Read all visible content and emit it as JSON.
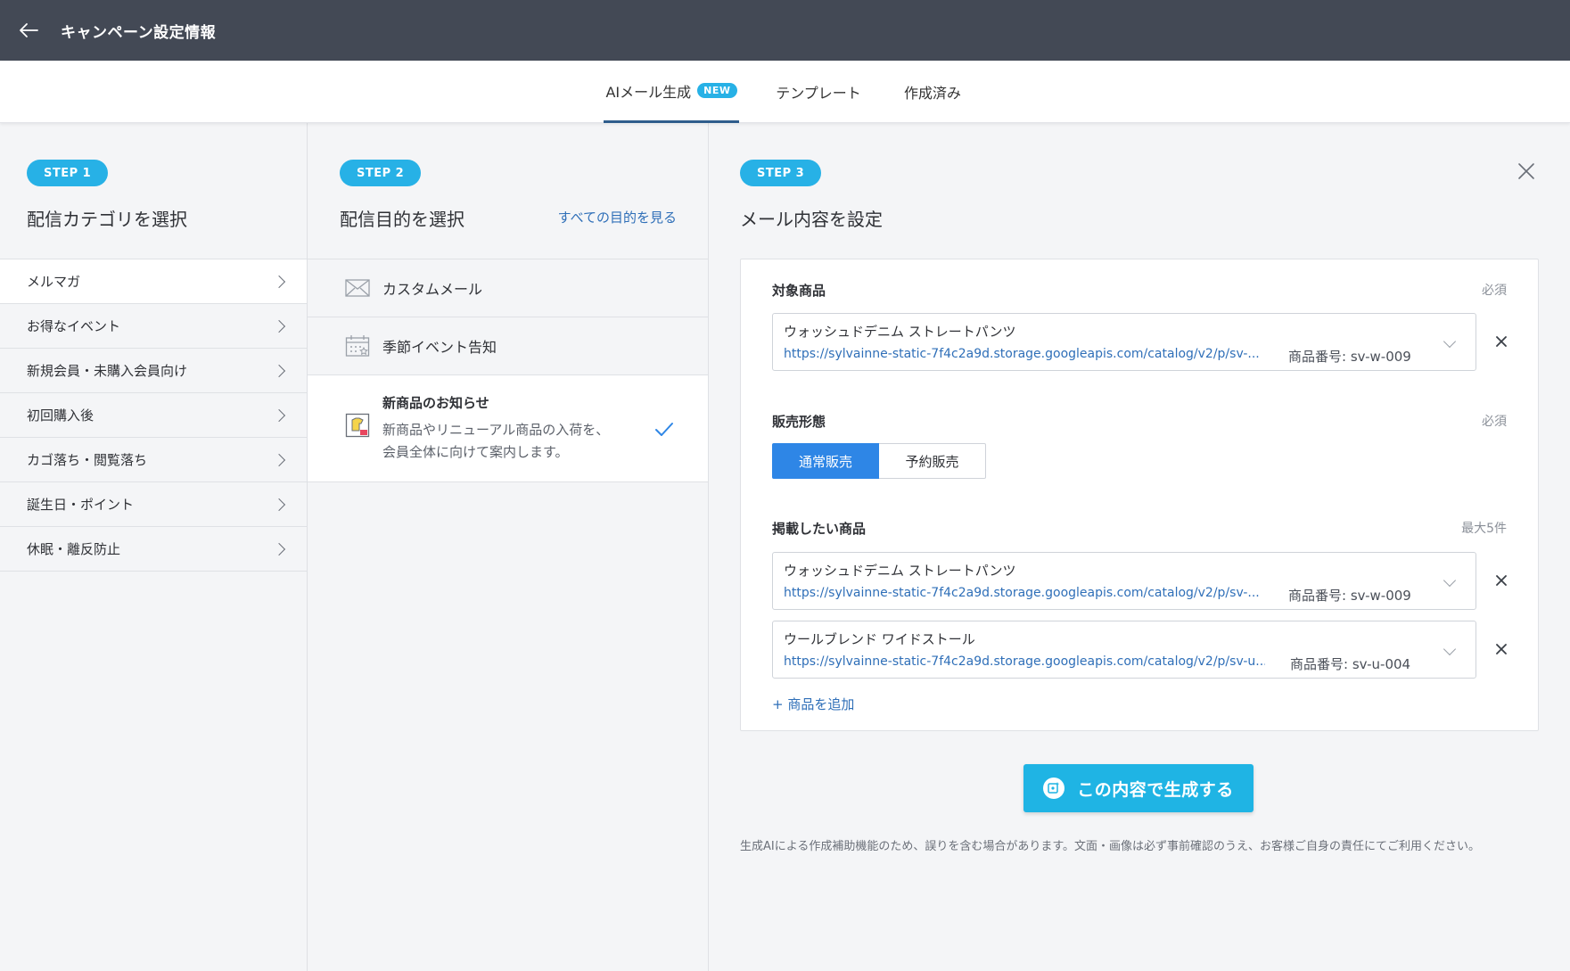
{
  "header": {
    "title": "キャンペーン設定情報"
  },
  "tabs": [
    {
      "label": "AIメール生成",
      "badge": "NEW"
    },
    {
      "label": "テンプレート"
    },
    {
      "label": "作成済み"
    }
  ],
  "step1": {
    "step_label": "STEP 1",
    "heading": "配信カテゴリを選択",
    "items": [
      {
        "label": "メルマガ"
      },
      {
        "label": "お得なイベント"
      },
      {
        "label": "新規会員・未購入会員向け"
      },
      {
        "label": "初回購入後"
      },
      {
        "label": "カゴ落ち・閲覧落ち"
      },
      {
        "label": "誕生日・ポイント"
      },
      {
        "label": "休眠・離反防止"
      }
    ]
  },
  "step2": {
    "step_label": "STEP 2",
    "heading": "配信目的を選択",
    "all_link": "すべての目的を見る",
    "items": [
      {
        "label": "カスタムメール",
        "icon": "envelope-icon"
      },
      {
        "label": "季節イベント告知",
        "icon": "calendar-icon"
      },
      {
        "label": "新商品のお知らせ",
        "icon": "new-product-icon",
        "description_line1": "新商品やリニューアル商品の入荷を、",
        "description_line2": "会員全体に向けて案内します。"
      }
    ]
  },
  "step3": {
    "step_label": "STEP 3",
    "heading": "メール内容を設定",
    "target_product": {
      "label": "対象商品",
      "required": "必須",
      "name": "ウォッシュドデニム ストレートパンツ",
      "url": "https://sylvainne-static-7f4c2a9d.storage.googleapis.com/catalog/v2/p/sv-...",
      "code": "商品番号: sv-w-009"
    },
    "sales_type": {
      "label": "販売形態",
      "required": "必須",
      "options": [
        "通常販売",
        "予約販売"
      ],
      "selected": "通常販売"
    },
    "featured_products": {
      "label": "掲載したい商品",
      "limit": "最大5件",
      "items": [
        {
          "name": "ウォッシュドデニム ストレートパンツ",
          "url": "https://sylvainne-static-7f4c2a9d.storage.googleapis.com/catalog/v2/p/sv-...",
          "code": "商品番号: sv-w-009"
        },
        {
          "name": "ウールブレンド ワイドストール",
          "url": "https://sylvainne-static-7f4c2a9d.storage.googleapis.com/catalog/v2/p/sv-u...",
          "code": "商品番号: sv-u-004"
        }
      ],
      "add_label": "+ 商品を追加"
    },
    "generate_button": "この内容で生成する",
    "disclaimer": "生成AIによる作成補助機能のため、誤りを含む場合があります。文面・画像は必ず事前確認のうえ、お客様ご自身の責任にてご利用ください。"
  },
  "colors": {
    "header_bg": "#434955",
    "accent": "#27b1e6",
    "primary_button": "#2e86e6",
    "link": "#2f6fb8"
  }
}
